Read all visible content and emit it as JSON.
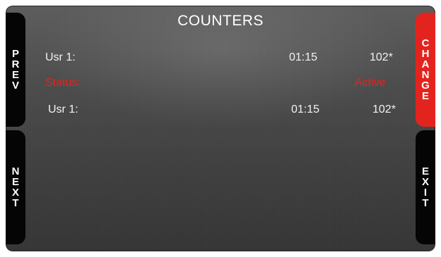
{
  "title": "COUNTERS",
  "buttons": {
    "prev": [
      "P",
      "R",
      "E",
      "V"
    ],
    "next": [
      "N",
      "E",
      "X",
      "T"
    ],
    "change": [
      "C",
      "H",
      "A",
      "N",
      "G",
      "E"
    ],
    "exit": [
      "E",
      "X",
      "I",
      "T"
    ]
  },
  "rows": [
    {
      "label": "Usr 1:",
      "time": "01:15",
      "value": "102*"
    },
    {
      "label": "Status:",
      "time": "",
      "value": "Active"
    },
    {
      "label": "Usr 1:",
      "time": "01:15",
      "value": "102*"
    }
  ],
  "colors": {
    "accent": "#e3241e",
    "button_bg": "#050505",
    "text": "#f2f2f2"
  }
}
